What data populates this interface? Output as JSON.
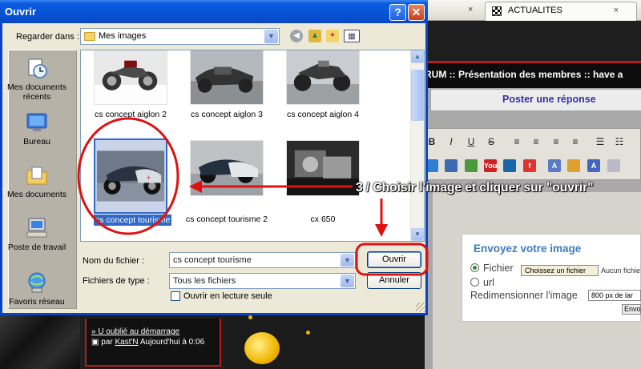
{
  "browser": {
    "tab_title": "ACTUALITES",
    "tab_close": "×",
    "forum_path": "RUM :: Présentation des membres :: have a",
    "reply_link": "Poster une réponse",
    "toolbar_letters": [
      "B",
      "I",
      "U",
      "S"
    ],
    "upload": {
      "title": "Envoyez votre image",
      "file_radio": "Fichier",
      "choose_button": "Choissez un fichier",
      "no_file": "Aucun fichie",
      "url_radio": "url",
      "resize_label": "Redimensionner l'image",
      "resize_value": "800 px de lar",
      "send_button": "Envo"
    },
    "post": {
      "title": "» U oublié au démarrage",
      "by": "par",
      "author": "Kast'N",
      "time": "Aujourd'hui à 0:06"
    }
  },
  "dialog": {
    "title": "Ouvrir",
    "help": "?",
    "close": "✕",
    "look_in_label": "Regarder dans :",
    "look_in_value": "Mes images",
    "places": [
      {
        "label": "Mes documents récents",
        "icon": "recent-documents-icon"
      },
      {
        "label": "Bureau",
        "icon": "desktop-icon"
      },
      {
        "label": "Mes documents",
        "icon": "my-documents-icon"
      },
      {
        "label": "Poste de travail",
        "icon": "my-computer-icon"
      },
      {
        "label": "Favoris réseau",
        "icon": "network-places-icon"
      }
    ],
    "files": [
      {
        "name": "cs concept aiglon 2",
        "selected": false
      },
      {
        "name": "cs concept aiglon 3",
        "selected": false
      },
      {
        "name": "cs concept aiglon 4",
        "selected": false
      },
      {
        "name": "cs concept tourisme",
        "selected": true
      },
      {
        "name": "cs concept tourisme 2",
        "selected": false
      },
      {
        "name": "cx 650",
        "selected": false
      }
    ],
    "filename_label": "Nom du fichier :",
    "filename_value": "cs concept tourisme",
    "filetype_label": "Fichiers de type :",
    "filetype_value": "Tous les fichiers",
    "readonly_label": "Ouvrir en lecture seule",
    "open_button": "Ouvrir",
    "cancel_button": "Annuler"
  },
  "annotation": {
    "instruction": "3 / Choisir l'image et cliquer sur  \"ouvrir\"",
    "color": "#e01010"
  }
}
